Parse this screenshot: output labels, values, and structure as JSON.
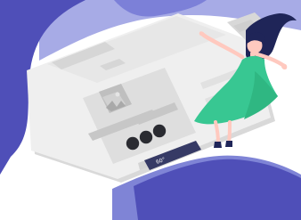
{
  "illustration": {
    "button_value": "60°",
    "icons": {
      "image_placeholder": "image-placeholder-icon",
      "person": "woman-figure-illustration"
    },
    "colors": {
      "background": "#ffffff",
      "swoosh_dark": "#4f4fb8",
      "swoosh_mid": "#6f73d1",
      "swoosh_light": "#a7abe6",
      "panel_light": "#f1f1f1",
      "panel_mid": "#e6e6e6",
      "panel_dark": "#d6d6d6",
      "button_dark": "#363a65",
      "dress": "#38c792",
      "hair": "#1f2558",
      "skin": "#ffc9bf",
      "dot_dark": "#2a2b31"
    }
  }
}
